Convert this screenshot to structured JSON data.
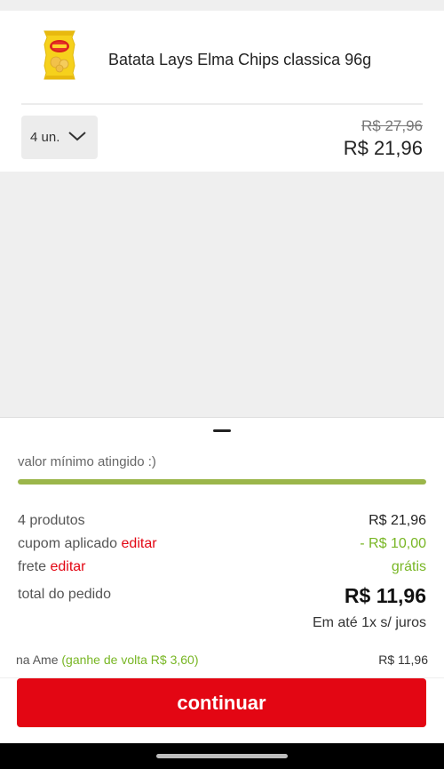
{
  "product": {
    "name": "Batata Lays Elma Chips classica 96g",
    "image_icon": "chips-bag-icon",
    "quantity": "4 un.",
    "old_price": "R$ 27,96",
    "price": "R$ 21,96"
  },
  "summary": {
    "min_message": "valor mínimo atingido :)",
    "min_progress": 1.0,
    "products_label": "4 produtos",
    "products_value": "R$ 21,96",
    "coupon_label": "cupom aplicado",
    "coupon_edit": "editar",
    "coupon_value": "- R$ 10,00",
    "shipping_label": "frete",
    "shipping_edit": "editar",
    "shipping_value": "grátis",
    "total_label": "total do pedido",
    "total_value": "R$ 11,96",
    "installments": "Em até 1x s/ juros",
    "ame_label": "na Ame",
    "ame_cashback": "(ganhe de volta R$ 3,60)",
    "ame_value": "R$ 11,96"
  },
  "actions": {
    "continue_label": "continuar"
  },
  "colors": {
    "accent_red": "#e30613",
    "green": "#78b624",
    "progress": "#9bb64a"
  }
}
